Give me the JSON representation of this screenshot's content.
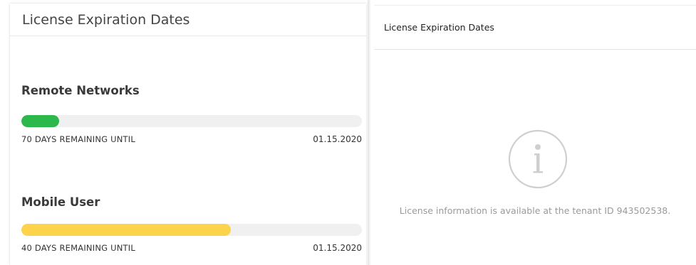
{
  "left_panel": {
    "title": "License Expiration Dates",
    "licenses": [
      {
        "name": "Remote Networks",
        "remaining_label": "70 DAYS REMAINING UNTIL",
        "date": "01.15.2020",
        "progress_fraction": 0.11,
        "bar_color": "#2db84b"
      },
      {
        "name": "Mobile User",
        "remaining_label": "40 DAYS REMAINING UNTIL",
        "date": "01.15.2020",
        "progress_fraction": 0.615,
        "bar_color": "#fcd34a"
      }
    ]
  },
  "right_panel": {
    "title": "License Expiration Dates",
    "icon": "info-circle-icon",
    "message": "License information is available at the tenant ID 943502538."
  }
}
